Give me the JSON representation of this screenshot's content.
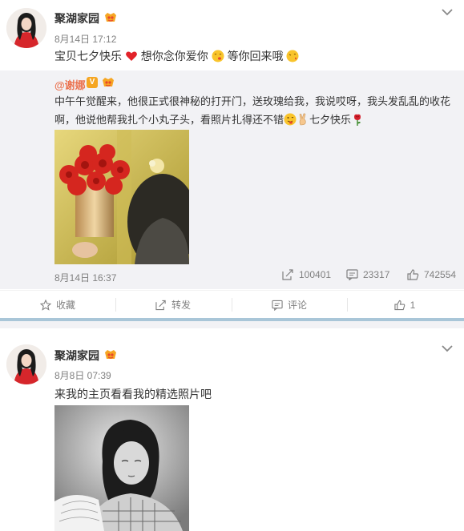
{
  "posts": [
    {
      "author": "聚湖家园",
      "timestamp": "8月14日 17:12",
      "content_parts": [
        "宝贝七夕快乐",
        "想你念你爱你",
        "等你回来哦"
      ],
      "emojis": [
        "heart-emoji",
        "kiss-emoji",
        "kiss-emoji"
      ],
      "repost": {
        "author": "@谢娜",
        "text": "中午午觉醒来，他很正式很神秘的打开门，送玫瑰给我，我说哎呀，我头发乱乱的收花啊，他说他帮我扎个小丸子头，看照片扎得还不错",
        "text_tail": "七夕快乐",
        "time": "8月14日 16:37",
        "forward_count": "100401",
        "comment_count": "23317",
        "like_count": "742554"
      },
      "actions": {
        "favorite": "收藏",
        "forward": "转发",
        "comment": "评论",
        "like": "1"
      }
    },
    {
      "author": "聚湖家园",
      "timestamp": "8月8日 07:39",
      "content": "来我的主页看看我的精选照片吧"
    }
  ],
  "colors": {
    "accent": "#eb7350",
    "repost_bg": "#f2f2f5",
    "separator_bar": "#a9c6d8",
    "meta_text": "#808080"
  }
}
